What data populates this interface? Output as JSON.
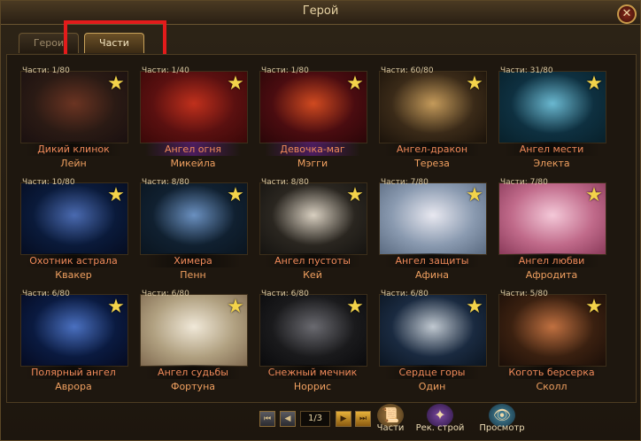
{
  "window": {
    "title": "Герой",
    "close_glyph": "✕"
  },
  "tabs": [
    {
      "label": "Герои"
    },
    {
      "label": "Части"
    }
  ],
  "cards": [
    {
      "parts": "Части: 1/80",
      "title": "Дикий клинок",
      "name": "Лейн",
      "title_style": "plain",
      "colors": [
        "#2a1a14",
        "#6b3422",
        "#1a1010"
      ]
    },
    {
      "parts": "Части: 1/40",
      "title": "Ангел огня",
      "name": "Микейла",
      "title_style": "purple",
      "colors": [
        "#5a1010",
        "#c0301c",
        "#3a0808"
      ]
    },
    {
      "parts": "Части: 1/80",
      "title": "Девочка-маг",
      "name": "Мэгги",
      "title_style": "purple",
      "colors": [
        "#4a0c10",
        "#d04a20",
        "#2a0608"
      ]
    },
    {
      "parts": "Части: 60/80",
      "title": "Ангел-дракон",
      "name": "Тереза",
      "title_style": "plain",
      "colors": [
        "#3a2a18",
        "#c49a5a",
        "#1a120a"
      ]
    },
    {
      "parts": "Части: 31/80",
      "title": "Ангел мести",
      "name": "Электа",
      "title_style": "plain",
      "colors": [
        "#0e3040",
        "#6ab8d0",
        "#08202a"
      ]
    },
    {
      "parts": "Части: 10/80",
      "title": "Охотник астрала",
      "name": "Квакер",
      "title_style": "plain",
      "colors": [
        "#0a1a3a",
        "#4a6ab0",
        "#050c20"
      ]
    },
    {
      "parts": "Части: 8/80",
      "title": "Химера",
      "name": "Пенн",
      "title_style": "plain",
      "colors": [
        "#102030",
        "#6a90c0",
        "#0a141e"
      ]
    },
    {
      "parts": "Части: 8/80",
      "title": "Ангел пустоты",
      "name": "Кей",
      "title_style": "plain",
      "colors": [
        "#2a2620",
        "#d8cfc0",
        "#151310"
      ]
    },
    {
      "parts": "Части: 7/80",
      "title": "Ангел защиты",
      "name": "Афина",
      "title_style": "plain",
      "colors": [
        "#8a9ab0",
        "#e8e8f0",
        "#5a6a80"
      ]
    },
    {
      "parts": "Части: 7/80",
      "title": "Ангел любви",
      "name": "Афродита",
      "title_style": "plain",
      "colors": [
        "#c06a8a",
        "#f4c8d8",
        "#8a3a5a"
      ]
    },
    {
      "parts": "Части: 6/80",
      "title": "Полярный ангел",
      "name": "Аврора",
      "title_style": "plain",
      "colors": [
        "#0a1a40",
        "#4a70c0",
        "#050a20"
      ]
    },
    {
      "parts": "Части: 6/80",
      "title": "Ангел судьбы",
      "name": "Фортуна",
      "title_style": "plain",
      "colors": [
        "#b0a080",
        "#f0e8d8",
        "#806a50"
      ]
    },
    {
      "parts": "Части: 6/80",
      "title": "Снежный мечник",
      "name": "Норрис",
      "title_style": "plain",
      "colors": [
        "#1a1a1c",
        "#6a6a70",
        "#0a0a0c"
      ]
    },
    {
      "parts": "Части: 6/80",
      "title": "Сердце горы",
      "name": "Один",
      "title_style": "plain",
      "colors": [
        "#1a2a40",
        "#c0c8d0",
        "#0a1420"
      ]
    },
    {
      "parts": "Части: 5/80",
      "title": "Коготь берсерка",
      "name": "Сколл",
      "title_style": "plain",
      "colors": [
        "#3a2010",
        "#c07040",
        "#1a0e08"
      ]
    }
  ],
  "star_icon": "star-badge-icon",
  "pagination": {
    "first": "⏮",
    "prev": "◀",
    "page": "1/3",
    "next": "▶",
    "last": "⏭"
  },
  "actions": [
    {
      "label": "Части",
      "icon": "scroll-icon",
      "glyph": "📜"
    },
    {
      "label": "Рек. строй",
      "icon": "formation-icon",
      "glyph": "✦"
    },
    {
      "label": "Просмотр",
      "icon": "view-icon",
      "glyph": "👁"
    }
  ]
}
